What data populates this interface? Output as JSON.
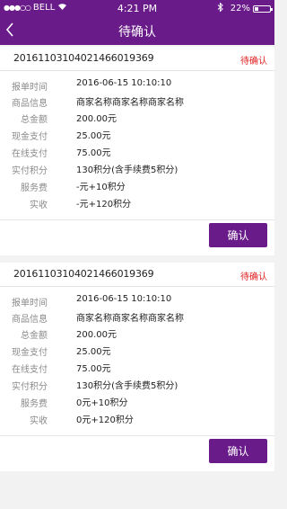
{
  "status_bar": {
    "carrier": "BELL",
    "time": "4:21 PM",
    "battery": "22%",
    "battery_level": 0.22
  },
  "nav": {
    "title": "待确认"
  },
  "icons": {
    "back": "chevron-left-icon",
    "signal": "signal-dots-icon",
    "wifi": "wifi-icon",
    "bluetooth": "bluetooth-icon",
    "battery": "battery-icon"
  },
  "colors": {
    "brand": "#6a1b8a",
    "status": "#e02020"
  },
  "orders": [
    {
      "number": "20161103104021466019369",
      "status": "待确认",
      "rows": [
        {
          "label": "报单时间",
          "value": "2016-06-15  10:10:10"
        },
        {
          "label": "商品信息",
          "value": "商家名称商家名称商家名称"
        },
        {
          "label": "总金额",
          "value": "200.00元"
        },
        {
          "label": "现金支付",
          "value": "25.00元"
        },
        {
          "label": "在线支付",
          "value": "75.00元"
        },
        {
          "label": "实付积分",
          "value": "130积分(含手续费5积分)"
        },
        {
          "label": "服务费",
          "value": "-元+10积分"
        },
        {
          "label": "实收",
          "value": "-元+120积分"
        }
      ],
      "confirm_label": "确认"
    },
    {
      "number": "20161103104021466019369",
      "status": "待确认",
      "rows": [
        {
          "label": "报单时间",
          "value": "2016-06-15  10:10:10"
        },
        {
          "label": "商品信息",
          "value": "商家名称商家名称商家名称"
        },
        {
          "label": "总金额",
          "value": "200.00元"
        },
        {
          "label": "现金支付",
          "value": "25.00元"
        },
        {
          "label": "在线支付",
          "value": "75.00元"
        },
        {
          "label": "实付积分",
          "value": "130积分(含手续费5积分)"
        },
        {
          "label": "服务费",
          "value": "0元+10积分"
        },
        {
          "label": "实收",
          "value": "0元+120积分"
        }
      ],
      "confirm_label": "确认"
    }
  ]
}
